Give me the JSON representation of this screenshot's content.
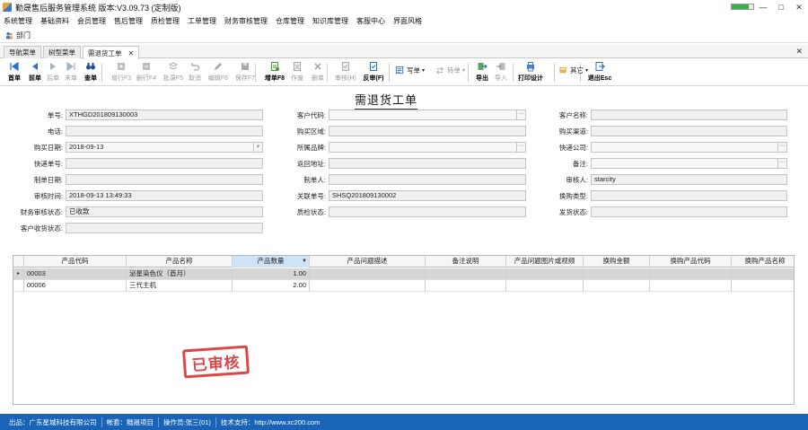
{
  "window": {
    "title": "勤晟售后服务管理系统 版本:V3.09.73 (定制版)",
    "progress": 0.8
  },
  "menubar": [
    "系统管理",
    "基础资料",
    "会员管理",
    "售后管理",
    "质检管理",
    "工单管理",
    "财务审核管理",
    "仓库管理",
    "知识库管理",
    "客服中心",
    "界面风格"
  ],
  "dept": {
    "label": "部门"
  },
  "tabs": [
    "导航菜单",
    "树型菜单",
    "需退货工单"
  ],
  "toolbar": {
    "buttons": [
      {
        "label": "首单",
        "icon": "first-icon",
        "disabled": false
      },
      {
        "label": "前单",
        "icon": "prev-icon",
        "disabled": false
      },
      {
        "label": "后单",
        "icon": "next-icon",
        "disabled": true
      },
      {
        "label": "末单",
        "icon": "last-icon",
        "disabled": true
      },
      {
        "label": "查单",
        "icon": "binoculars-icon",
        "disabled": false
      },
      {
        "label": "增行F3",
        "icon": "add-row-icon",
        "disabled": true
      },
      {
        "label": "删行F4",
        "icon": "delete-row-icon",
        "disabled": true
      },
      {
        "label": "批录F5",
        "icon": "batch-icon",
        "disabled": true
      },
      {
        "label": "取消",
        "icon": "undo-icon",
        "disabled": true
      },
      {
        "label": "编辑F6",
        "icon": "edit-icon",
        "disabled": true
      },
      {
        "label": "保存F7",
        "icon": "save-icon",
        "disabled": true
      },
      {
        "label": "增单F8",
        "icon": "new-doc-icon",
        "disabled": false
      },
      {
        "label": "作废",
        "icon": "void-icon",
        "disabled": true
      },
      {
        "label": "删单",
        "icon": "delete-icon",
        "disabled": true
      },
      {
        "label": "审核(H)",
        "icon": "audit-icon",
        "disabled": true
      },
      {
        "label": "反审(F)",
        "icon": "unaudit-icon",
        "disabled": false
      },
      {
        "label": "导出",
        "icon": "export-icon",
        "disabled": false
      },
      {
        "label": "导入",
        "icon": "import-icon",
        "disabled": true
      },
      {
        "label": "打印设计",
        "icon": "print-design-icon",
        "disabled": false
      },
      {
        "label": "退出Esc",
        "icon": "exit-icon",
        "disabled": false
      }
    ],
    "dropdowns": [
      {
        "label": "写单",
        "icon": "write-icon",
        "disabled": false
      },
      {
        "label": "转单",
        "icon": "transfer-icon",
        "disabled": true
      },
      {
        "label": "其它",
        "icon": "other-icon",
        "disabled": false
      }
    ]
  },
  "form": {
    "title": "需退货工单",
    "fields": {
      "order_no": {
        "label": "单号:",
        "value": "XTHGD201809130003"
      },
      "customer_code": {
        "label": "客户代码:",
        "value": ""
      },
      "customer_name": {
        "label": "客户名称:",
        "value": ""
      },
      "phone": {
        "label": "电话:",
        "value": ""
      },
      "purchase_region": {
        "label": "购买区域:",
        "value": ""
      },
      "purchase_channel": {
        "label": "购买渠道:",
        "value": ""
      },
      "purchase_date": {
        "label": "购买日期:",
        "value": "2018-09-13"
      },
      "brand": {
        "label": "所属品牌:",
        "value": ""
      },
      "courier": {
        "label": "快递公司:",
        "value": ""
      },
      "tracking_no": {
        "label": "快递单号:",
        "value": ""
      },
      "return_address": {
        "label": "返回地址:",
        "value": ""
      },
      "remark": {
        "label": "备注:",
        "value": ""
      },
      "creator_date": {
        "label": "制单日期:",
        "value": ""
      },
      "creator": {
        "label": "制单人:",
        "value": ""
      },
      "auditor": {
        "label": "审核人:",
        "value": "starcity"
      },
      "audit_time": {
        "label": "审核时间:",
        "value": "2018-09-13 13:49:33"
      },
      "related_no": {
        "label": "关联单号:",
        "value": "SHSQ201809130002"
      },
      "exchange_type": {
        "label": "换购类型:",
        "value": ""
      },
      "finance_status": {
        "label": "财务审核状态:",
        "value": "已收款"
      },
      "qc_status": {
        "label": "质检状态:",
        "value": ""
      },
      "ship_status": {
        "label": "发货状态:",
        "value": ""
      },
      "receive_status": {
        "label": "客户收货状态:",
        "value": ""
      }
    }
  },
  "grid": {
    "columns": [
      "产品代码",
      "产品名称",
      "产品数量",
      "产品问题描述",
      "备注说明",
      "产品问题图片或视频",
      "换购金额",
      "换购产品代码",
      "换购产品名称"
    ],
    "rows": [
      {
        "code": "00003",
        "name": "泌星染色仪（酋月）",
        "qty": "1.00"
      },
      {
        "code": "00006",
        "name": "三代主机",
        "qty": "2.00"
      }
    ]
  },
  "stamp": {
    "text": "已审核",
    "color": "#d9383a"
  },
  "statusbar": [
    "出品：广东星城科技有限公司",
    "帐套：黜晟项目",
    "操作员:张三(01)",
    "技术支持：http://www.xc200.com"
  ]
}
